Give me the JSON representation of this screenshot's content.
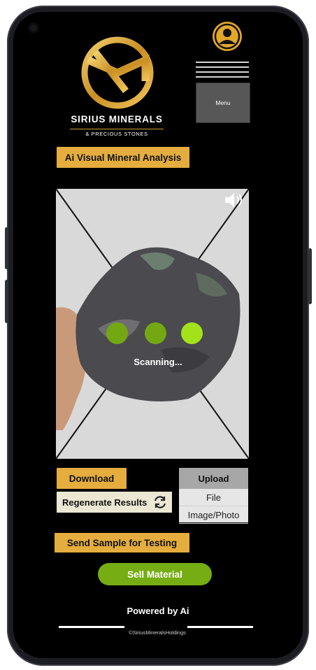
{
  "brand": {
    "name": "SIRIUS MINERALS",
    "tagline": "& PRECIOUS STONES"
  },
  "header": {
    "menu_label": "Menu"
  },
  "analysis_button": "Ai Visual Mineral Analysis",
  "scan": {
    "status": "Scanning..."
  },
  "actions": {
    "download": "Download",
    "regenerate": "Regenerate Results",
    "upload": {
      "title": "Upload",
      "options": [
        "File",
        "Image/Photo"
      ]
    },
    "send_sample": "Send Sample for Testing",
    "sell": "Sell Material"
  },
  "footer": {
    "powered": "Powered by Ai",
    "copyright": "©SiriusMineralsHoldings"
  },
  "colors": {
    "gold": "#e4ad3e",
    "green": "#76ad13",
    "dot_dark": "#73a812",
    "dot_light": "#a3e21a"
  }
}
